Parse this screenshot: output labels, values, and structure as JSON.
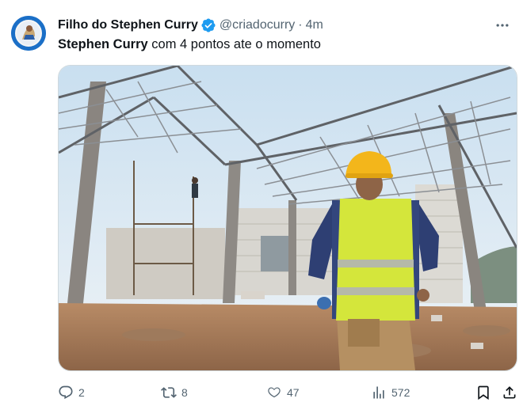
{
  "post": {
    "author_name": "Filho do Stephen Curry",
    "handle": "@criadocurry",
    "separator": "·",
    "time": "4m",
    "text_bold": "Stephen Curry",
    "text_rest": " com 4 pontos ate o momento",
    "media_alt": "Construction worker in yellow safety vest and hard hat at a building site with steel roof trusses"
  },
  "actions": {
    "replies": "2",
    "reposts": "8",
    "likes": "47",
    "views": "572"
  },
  "icons": {
    "verified": "verified-badge-icon",
    "more": "more-options-icon",
    "reply": "reply-icon",
    "repost": "repost-icon",
    "like": "heart-icon",
    "views": "views-chart-icon",
    "bookmark": "bookmark-icon",
    "share": "share-icon"
  },
  "colors": {
    "verified_blue": "#1d9bf0",
    "secondary_text": "#536471",
    "primary_text": "#0f1419"
  }
}
